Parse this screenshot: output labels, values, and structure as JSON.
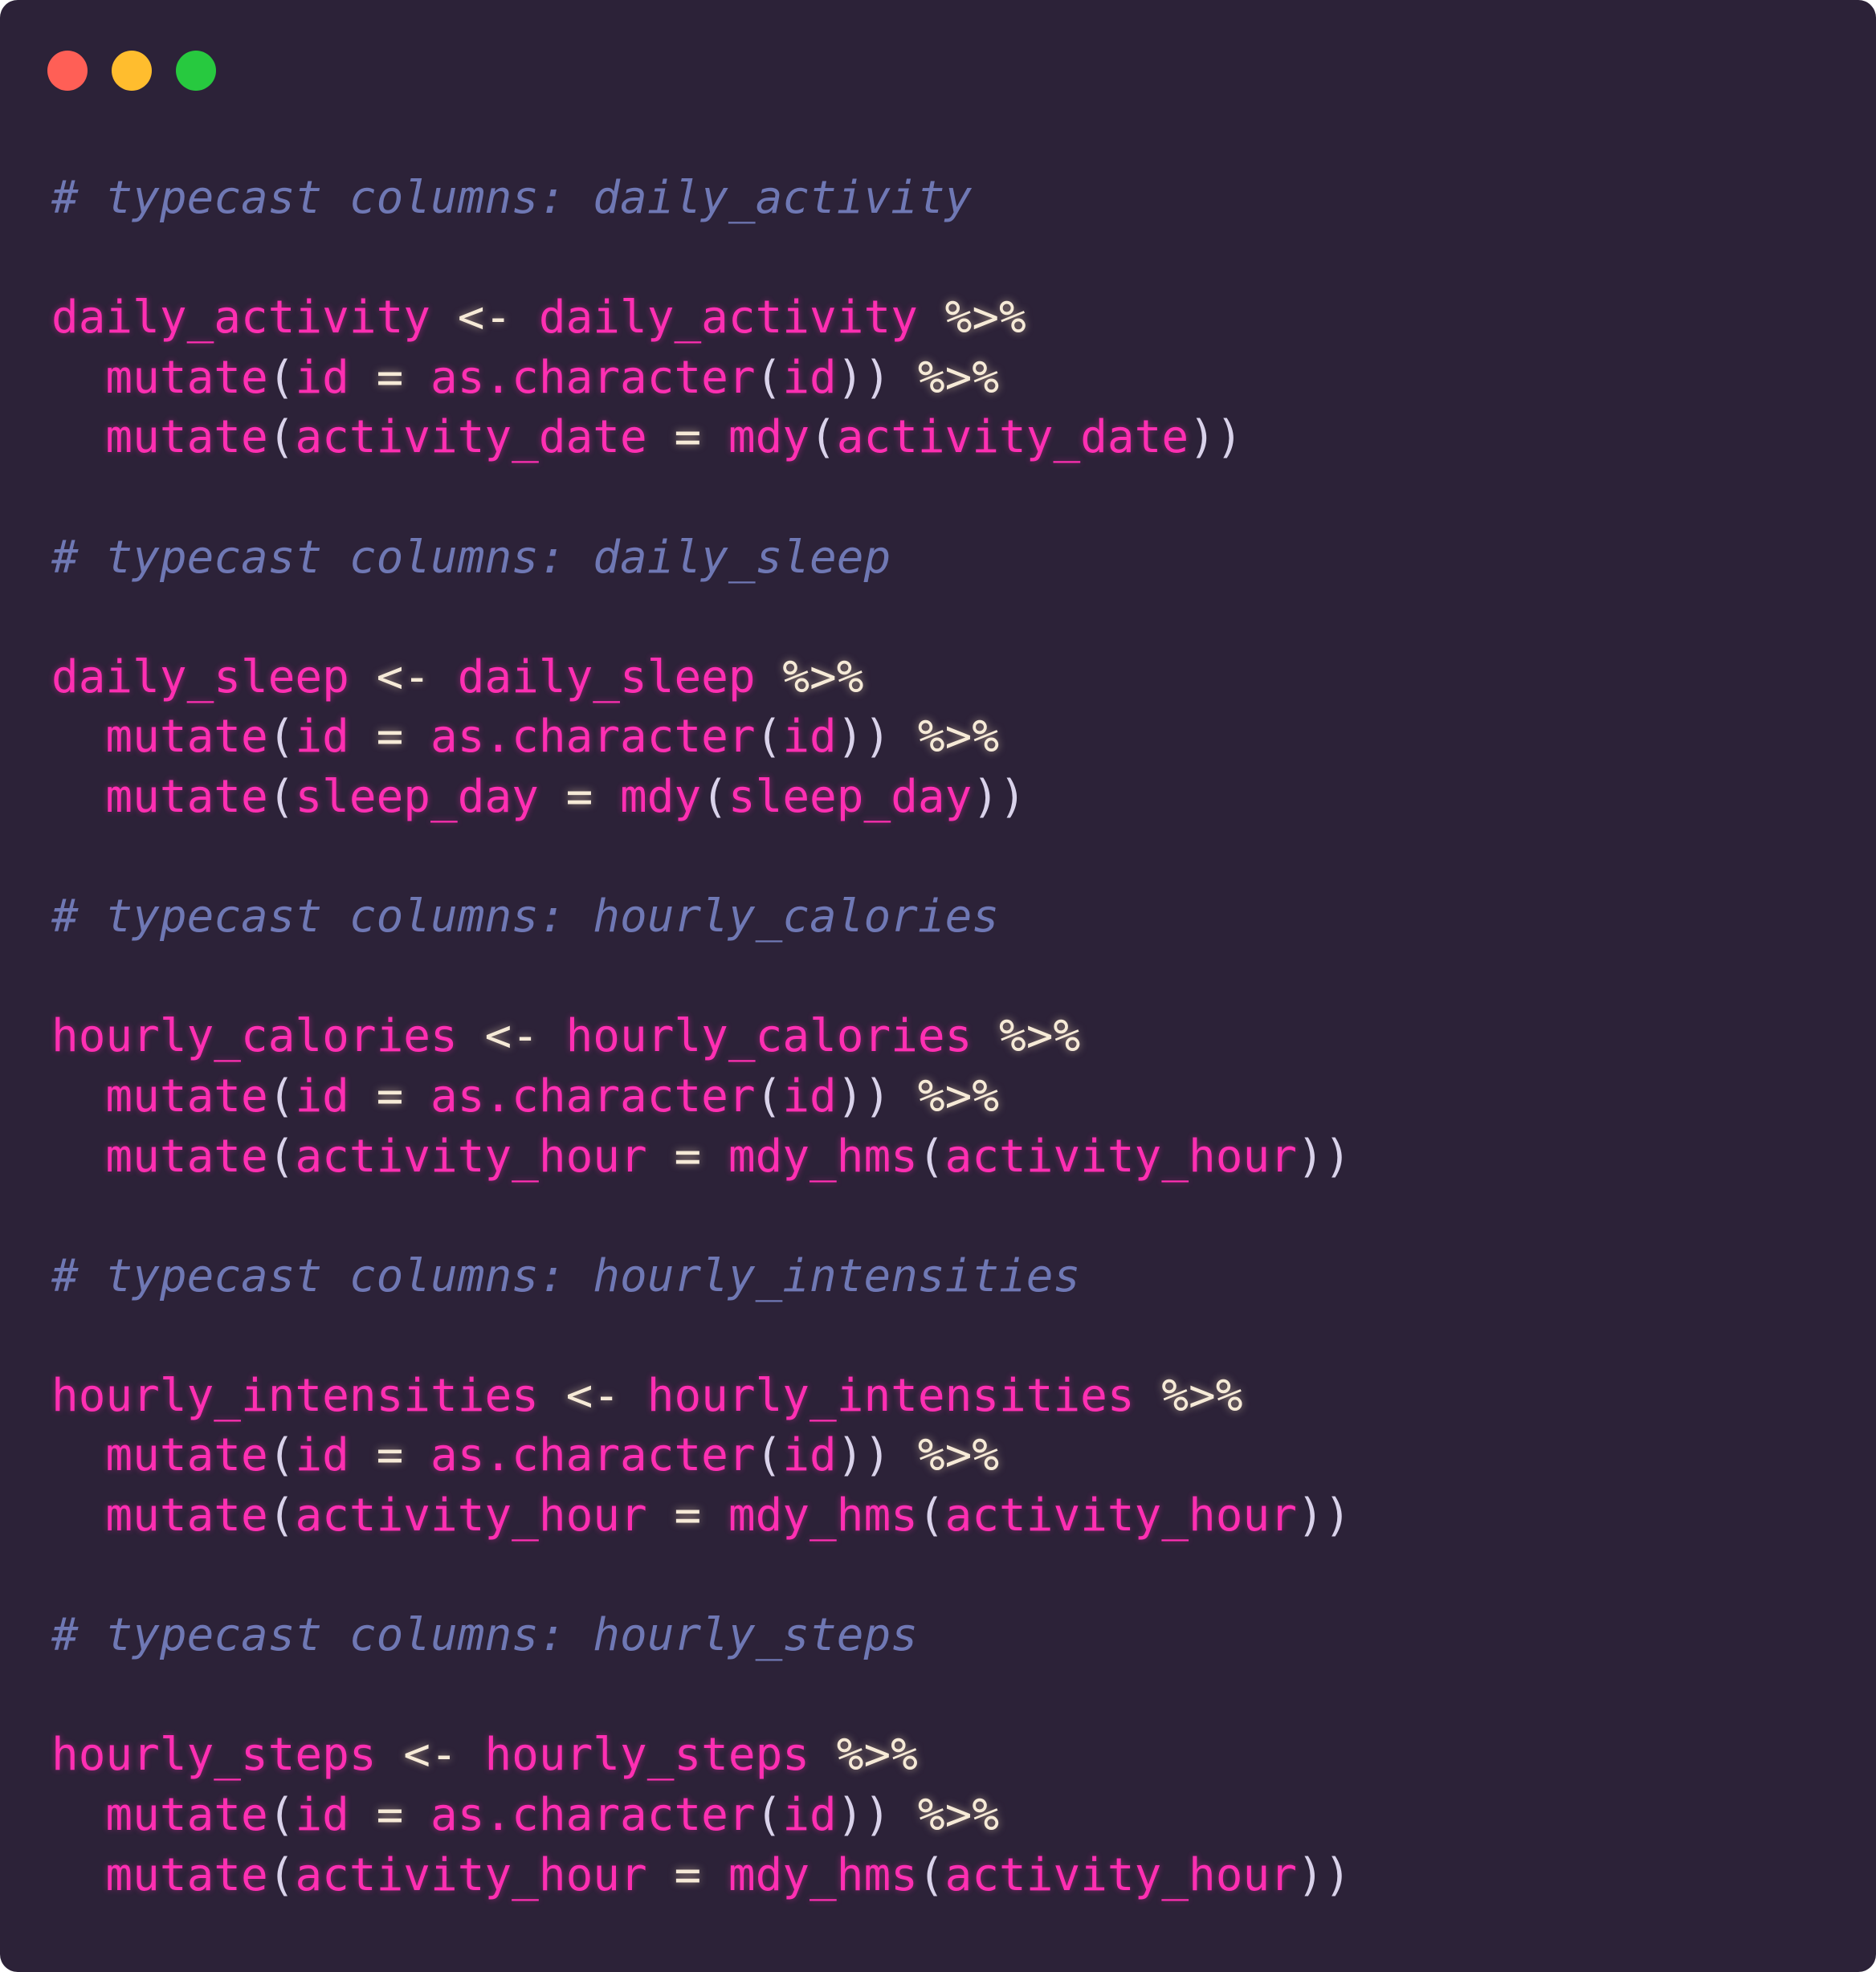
{
  "window": {
    "buttons": [
      {
        "name": "close",
        "color": "#ff5f56"
      },
      {
        "name": "minimize",
        "color": "#ffbd2e"
      },
      {
        "name": "maximize",
        "color": "#27c93f"
      }
    ]
  },
  "code": {
    "lines": [
      [
        {
          "t": "cm",
          "v": "# typecast columns: daily_activity"
        }
      ],
      [],
      [
        {
          "t": "id",
          "v": "daily_activity"
        },
        {
          "t": "op",
          "v": " <- "
        },
        {
          "t": "id",
          "v": "daily_activity"
        },
        {
          "t": "op",
          "v": " %>%"
        }
      ],
      [
        {
          "t": "id",
          "v": "  mutate"
        },
        {
          "t": "pn",
          "v": "("
        },
        {
          "t": "id",
          "v": "id"
        },
        {
          "t": "op",
          "v": " = "
        },
        {
          "t": "id",
          "v": "as.character"
        },
        {
          "t": "pn",
          "v": "("
        },
        {
          "t": "id",
          "v": "id"
        },
        {
          "t": "pn",
          "v": "))"
        },
        {
          "t": "op",
          "v": " %>%"
        }
      ],
      [
        {
          "t": "id",
          "v": "  mutate"
        },
        {
          "t": "pn",
          "v": "("
        },
        {
          "t": "id",
          "v": "activity_date"
        },
        {
          "t": "op",
          "v": " = "
        },
        {
          "t": "id",
          "v": "mdy"
        },
        {
          "t": "pn",
          "v": "("
        },
        {
          "t": "id",
          "v": "activity_date"
        },
        {
          "t": "pn",
          "v": "))"
        }
      ],
      [],
      [
        {
          "t": "cm",
          "v": "# typecast columns: daily_sleep"
        }
      ],
      [],
      [
        {
          "t": "id",
          "v": "daily_sleep"
        },
        {
          "t": "op",
          "v": " <- "
        },
        {
          "t": "id",
          "v": "daily_sleep"
        },
        {
          "t": "op",
          "v": " %>%"
        }
      ],
      [
        {
          "t": "id",
          "v": "  mutate"
        },
        {
          "t": "pn",
          "v": "("
        },
        {
          "t": "id",
          "v": "id"
        },
        {
          "t": "op",
          "v": " = "
        },
        {
          "t": "id",
          "v": "as.character"
        },
        {
          "t": "pn",
          "v": "("
        },
        {
          "t": "id",
          "v": "id"
        },
        {
          "t": "pn",
          "v": "))"
        },
        {
          "t": "op",
          "v": " %>%"
        }
      ],
      [
        {
          "t": "id",
          "v": "  mutate"
        },
        {
          "t": "pn",
          "v": "("
        },
        {
          "t": "id",
          "v": "sleep_day"
        },
        {
          "t": "op",
          "v": " = "
        },
        {
          "t": "id",
          "v": "mdy"
        },
        {
          "t": "pn",
          "v": "("
        },
        {
          "t": "id",
          "v": "sleep_day"
        },
        {
          "t": "pn",
          "v": "))"
        }
      ],
      [],
      [
        {
          "t": "cm",
          "v": "# typecast columns: hourly_calories"
        }
      ],
      [],
      [
        {
          "t": "id",
          "v": "hourly_calories"
        },
        {
          "t": "op",
          "v": " <- "
        },
        {
          "t": "id",
          "v": "hourly_calories"
        },
        {
          "t": "op",
          "v": " %>%"
        }
      ],
      [
        {
          "t": "id",
          "v": "  mutate"
        },
        {
          "t": "pn",
          "v": "("
        },
        {
          "t": "id",
          "v": "id"
        },
        {
          "t": "op",
          "v": " = "
        },
        {
          "t": "id",
          "v": "as.character"
        },
        {
          "t": "pn",
          "v": "("
        },
        {
          "t": "id",
          "v": "id"
        },
        {
          "t": "pn",
          "v": "))"
        },
        {
          "t": "op",
          "v": " %>%"
        }
      ],
      [
        {
          "t": "id",
          "v": "  mutate"
        },
        {
          "t": "pn",
          "v": "("
        },
        {
          "t": "id",
          "v": "activity_hour"
        },
        {
          "t": "op",
          "v": " = "
        },
        {
          "t": "id",
          "v": "mdy_hms"
        },
        {
          "t": "pn",
          "v": "("
        },
        {
          "t": "id",
          "v": "activity_hour"
        },
        {
          "t": "pn",
          "v": "))"
        }
      ],
      [],
      [
        {
          "t": "cm",
          "v": "# typecast columns: hourly_intensities"
        }
      ],
      [],
      [
        {
          "t": "id",
          "v": "hourly_intensities"
        },
        {
          "t": "op",
          "v": " <- "
        },
        {
          "t": "id",
          "v": "hourly_intensities"
        },
        {
          "t": "op",
          "v": " %>%"
        }
      ],
      [
        {
          "t": "id",
          "v": "  mutate"
        },
        {
          "t": "pn",
          "v": "("
        },
        {
          "t": "id",
          "v": "id"
        },
        {
          "t": "op",
          "v": " = "
        },
        {
          "t": "id",
          "v": "as.character"
        },
        {
          "t": "pn",
          "v": "("
        },
        {
          "t": "id",
          "v": "id"
        },
        {
          "t": "pn",
          "v": "))"
        },
        {
          "t": "op",
          "v": " %>%"
        }
      ],
      [
        {
          "t": "id",
          "v": "  mutate"
        },
        {
          "t": "pn",
          "v": "("
        },
        {
          "t": "id",
          "v": "activity_hour"
        },
        {
          "t": "op",
          "v": " = "
        },
        {
          "t": "id",
          "v": "mdy_hms"
        },
        {
          "t": "pn",
          "v": "("
        },
        {
          "t": "id",
          "v": "activity_hour"
        },
        {
          "t": "pn",
          "v": "))"
        }
      ],
      [],
      [
        {
          "t": "cm",
          "v": "# typecast columns: hourly_steps"
        }
      ],
      [],
      [
        {
          "t": "id",
          "v": "hourly_steps"
        },
        {
          "t": "op",
          "v": " <- "
        },
        {
          "t": "id",
          "v": "hourly_steps"
        },
        {
          "t": "op",
          "v": " %>%"
        }
      ],
      [
        {
          "t": "id",
          "v": "  mutate"
        },
        {
          "t": "pn",
          "v": "("
        },
        {
          "t": "id",
          "v": "id"
        },
        {
          "t": "op",
          "v": " = "
        },
        {
          "t": "id",
          "v": "as.character"
        },
        {
          "t": "pn",
          "v": "("
        },
        {
          "t": "id",
          "v": "id"
        },
        {
          "t": "pn",
          "v": "))"
        },
        {
          "t": "op",
          "v": " %>%"
        }
      ],
      [
        {
          "t": "id",
          "v": "  mutate"
        },
        {
          "t": "pn",
          "v": "("
        },
        {
          "t": "id",
          "v": "activity_hour"
        },
        {
          "t": "op",
          "v": " = "
        },
        {
          "t": "id",
          "v": "mdy_hms"
        },
        {
          "t": "pn",
          "v": "("
        },
        {
          "t": "id",
          "v": "activity_hour"
        },
        {
          "t": "pn",
          "v": "))"
        }
      ]
    ]
  }
}
